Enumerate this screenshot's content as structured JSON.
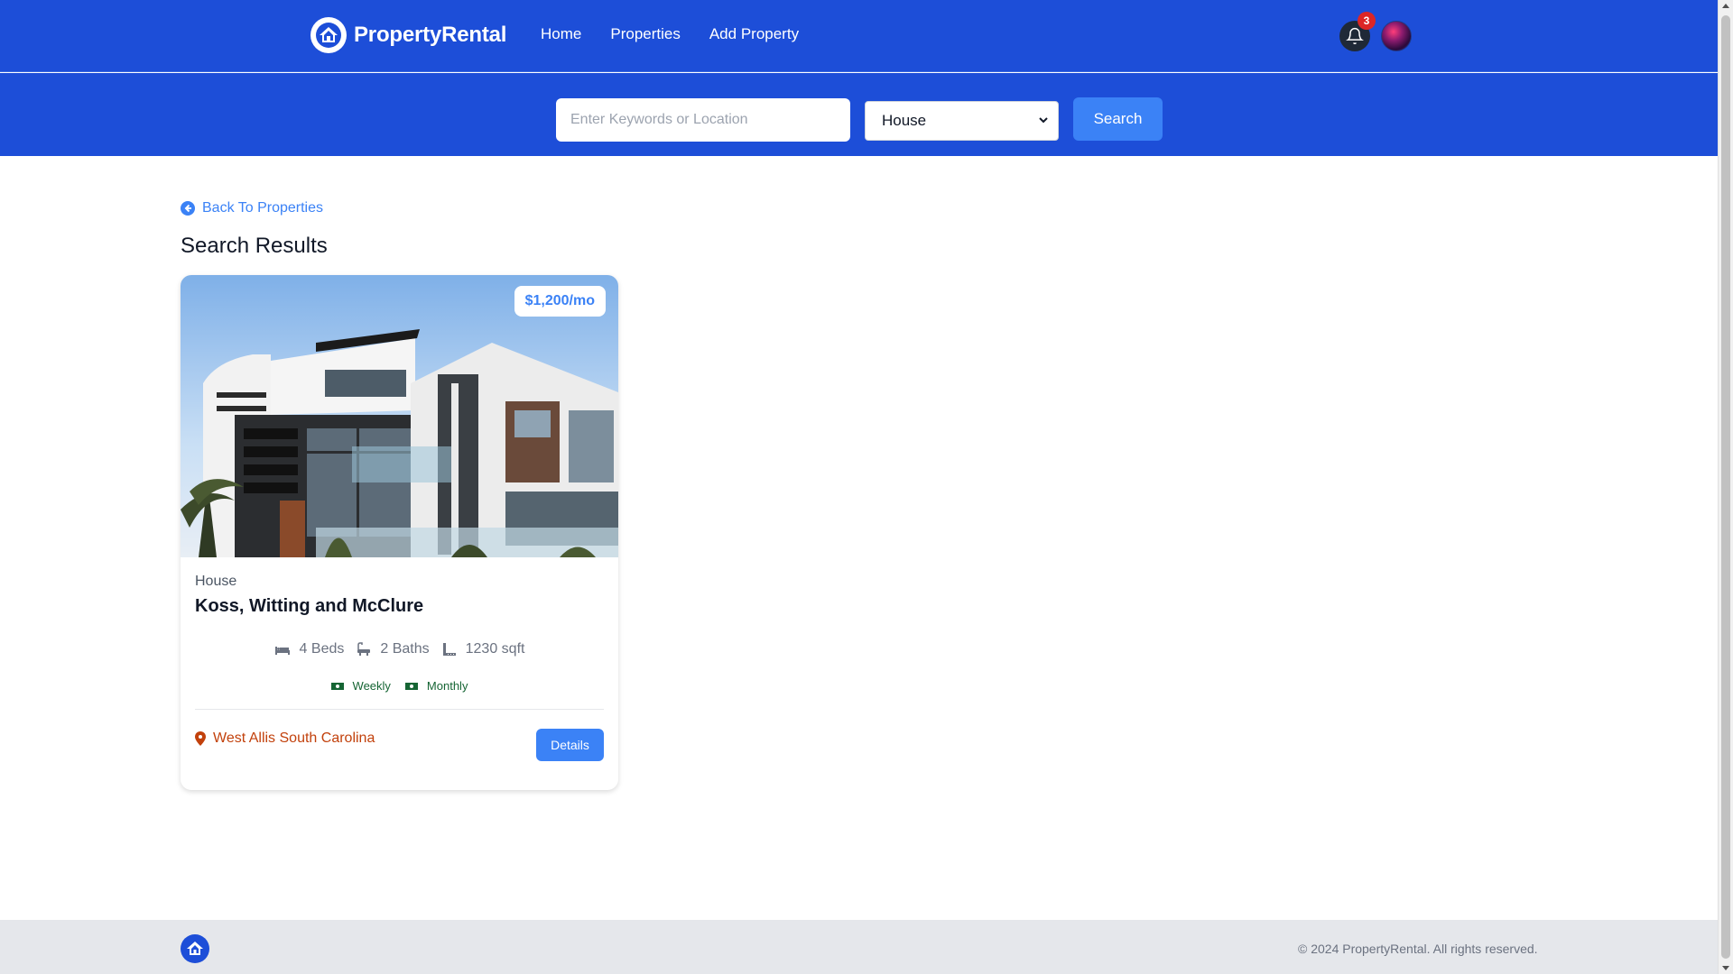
{
  "nav": {
    "brand": "PropertyRental",
    "links": [
      "Home",
      "Properties",
      "Add Property"
    ],
    "notification_count": "3",
    "icons": {
      "logo": "house-icon",
      "bell": "bell-icon",
      "avatar": "avatar"
    }
  },
  "search": {
    "placeholder": "Enter Keywords or Location",
    "selected_type": "House",
    "button_label": "Search"
  },
  "main": {
    "back_link": "Back To Properties",
    "results_title": "Search Results"
  },
  "properties": [
    {
      "price": "$1,200/mo",
      "type": "House",
      "name": "Koss, Witting and McClure",
      "beds": "4 Beds",
      "baths": "2 Baths",
      "sqft": "1230 sqft",
      "rates": [
        "Weekly",
        "Monthly"
      ],
      "location": "West Allis South Carolina",
      "details_label": "Details"
    }
  ],
  "footer": {
    "copyright": "© 2024 PropertyRental. All rights reserved."
  },
  "colors": {
    "primary": "#1d4ed8",
    "accent": "#3b82f6",
    "location": "#c2410c",
    "rates": "#166534",
    "badge": "#dc2626"
  }
}
